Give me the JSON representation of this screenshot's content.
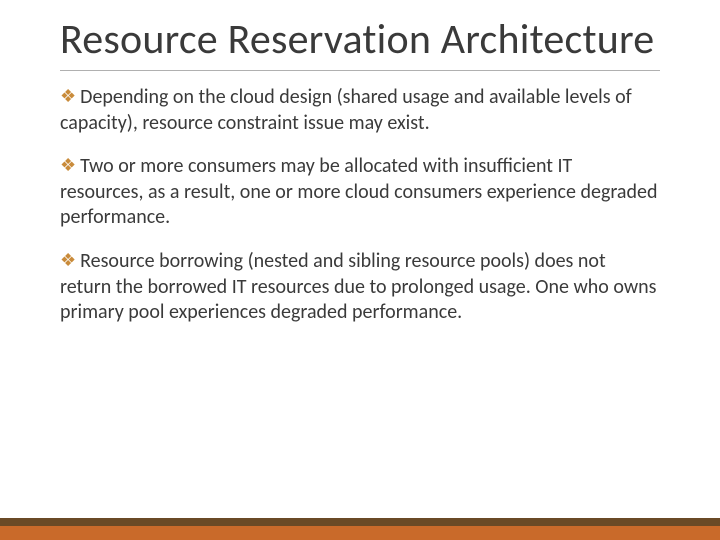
{
  "slide": {
    "title": "Resource Reservation Architecture",
    "bullets": [
      "Depending on the cloud design (shared usage and available levels of capacity), resource constraint issue may exist.",
      "Two or more consumers may be allocated with insufficient IT resources, as a result, one or more cloud consumers experience degraded performance.",
      "Resource borrowing (nested and sibling resource pools) does not return the borrowed IT resources due to prolonged usage. One who owns primary pool experiences degraded performance."
    ]
  }
}
